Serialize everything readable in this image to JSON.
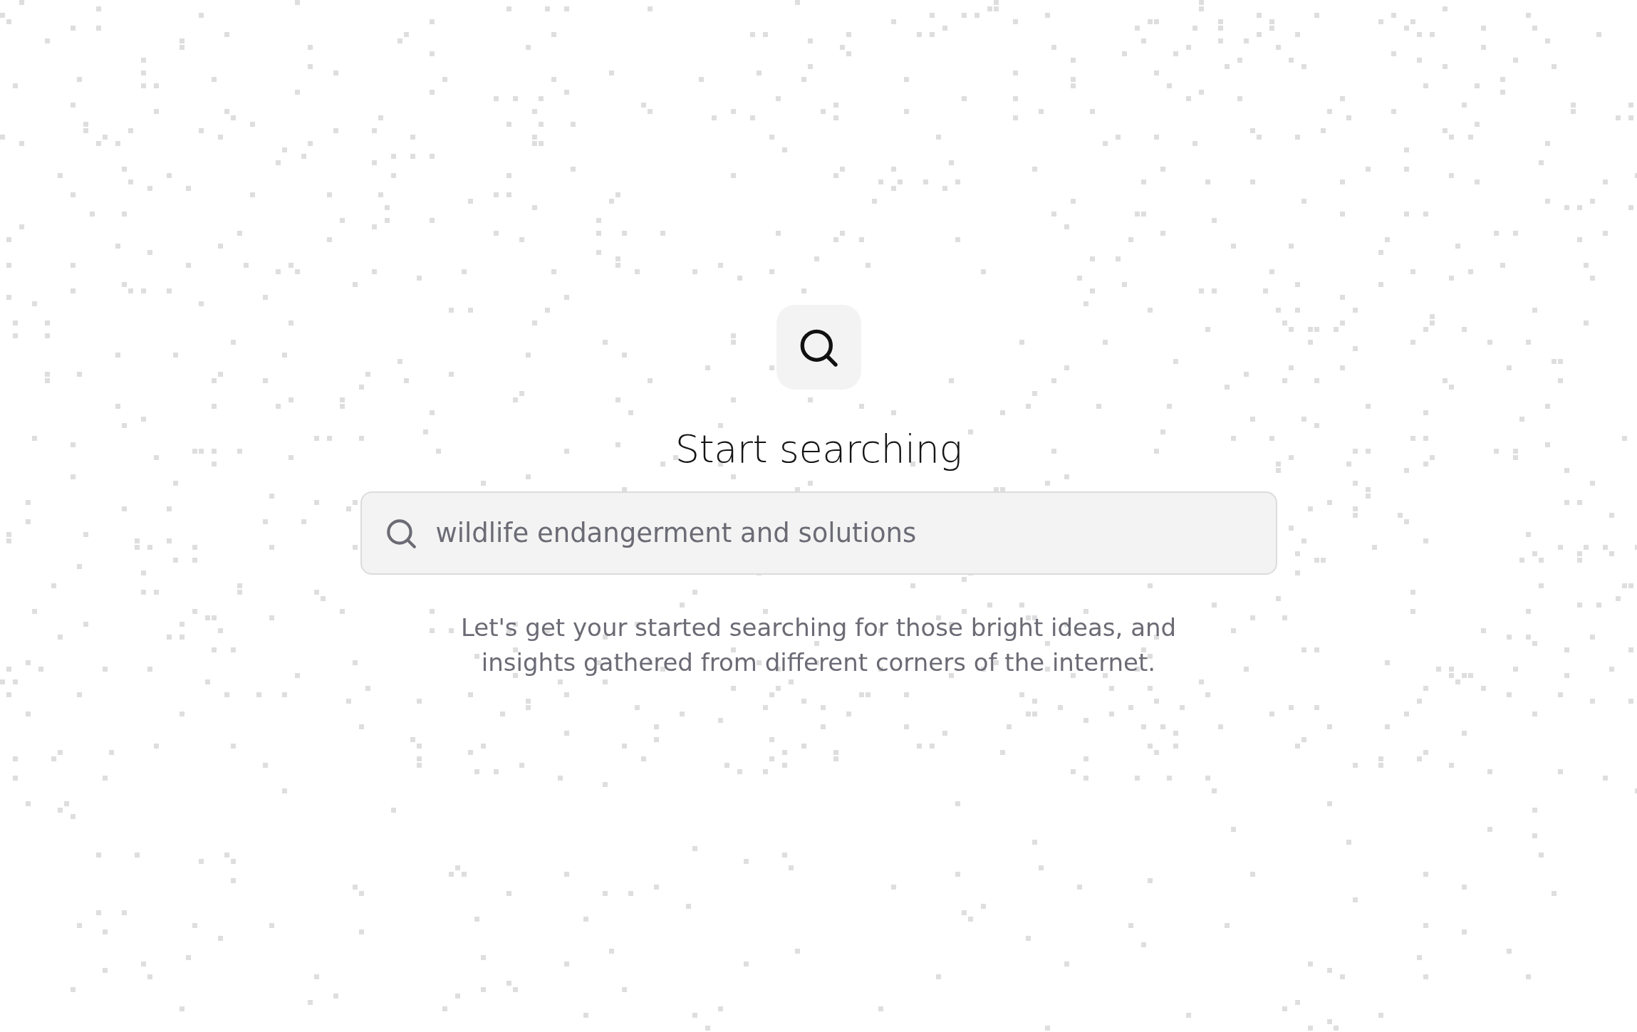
{
  "title": "Start searching",
  "search": {
    "placeholder": "wildlife endangerment and solutions"
  },
  "description": "Let's get your started searching for those bright ideas, and insights gathered from different corners of the internet."
}
